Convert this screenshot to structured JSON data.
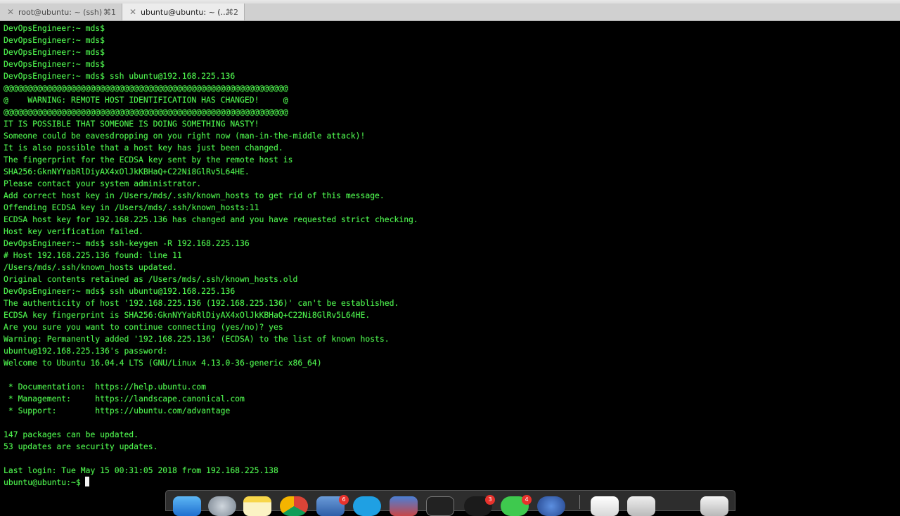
{
  "tabs": [
    {
      "title": "root@ubuntu: ~ (ssh)",
      "shortcut": "⌘1",
      "active": false
    },
    {
      "title": "ubuntu@ubuntu: ~ (...",
      "shortcut": "⌘2",
      "active": true
    }
  ],
  "terminal": {
    "text_color": "#4ef24e",
    "background": "#000000",
    "lines": [
      "DevOpsEngineer:~ mds$",
      "DevOpsEngineer:~ mds$",
      "DevOpsEngineer:~ mds$",
      "DevOpsEngineer:~ mds$",
      "DevOpsEngineer:~ mds$ ssh ubuntu@192.168.225.136",
      "@@@@@@@@@@@@@@@@@@@@@@@@@@@@@@@@@@@@@@@@@@@@@@@@@@@@@@@@@@@",
      "@    WARNING: REMOTE HOST IDENTIFICATION HAS CHANGED!     @",
      "@@@@@@@@@@@@@@@@@@@@@@@@@@@@@@@@@@@@@@@@@@@@@@@@@@@@@@@@@@@",
      "IT IS POSSIBLE THAT SOMEONE IS DOING SOMETHING NASTY!",
      "Someone could be eavesdropping on you right now (man-in-the-middle attack)!",
      "It is also possible that a host key has just been changed.",
      "The fingerprint for the ECDSA key sent by the remote host is",
      "SHA256:GknNYYabRlDiyAX4xOlJkKBHaQ+C22Ni8GlRv5L64HE.",
      "Please contact your system administrator.",
      "Add correct host key in /Users/mds/.ssh/known_hosts to get rid of this message.",
      "Offending ECDSA key in /Users/mds/.ssh/known_hosts:11",
      "ECDSA host key for 192.168.225.136 has changed and you have requested strict checking.",
      "Host key verification failed.",
      "DevOpsEngineer:~ mds$ ssh-keygen -R 192.168.225.136",
      "# Host 192.168.225.136 found: line 11",
      "/Users/mds/.ssh/known_hosts updated.",
      "Original contents retained as /Users/mds/.ssh/known_hosts.old",
      "DevOpsEngineer:~ mds$ ssh ubuntu@192.168.225.136",
      "The authenticity of host '192.168.225.136 (192.168.225.136)' can't be established.",
      "ECDSA key fingerprint is SHA256:GknNYYabRlDiyAX4xOlJkKBHaQ+C22Ni8GlRv5L64HE.",
      "Are you sure you want to continue connecting (yes/no)? yes",
      "Warning: Permanently added '192.168.225.136' (ECDSA) to the list of known hosts.",
      "ubuntu@192.168.225.136's password:",
      "Welcome to Ubuntu 16.04.4 LTS (GNU/Linux 4.13.0-36-generic x86_64)",
      "",
      " * Documentation:  https://help.ubuntu.com",
      " * Management:     https://landscape.canonical.com",
      " * Support:        https://ubuntu.com/advantage",
      "",
      "147 packages can be updated.",
      "53 updates are security updates.",
      "",
      "Last login: Tue May 15 00:31:05 2018 from 192.168.225.138",
      "ubuntu@ubuntu:~$"
    ]
  },
  "dock": {
    "badges": [
      "6",
      "3",
      "4"
    ]
  }
}
